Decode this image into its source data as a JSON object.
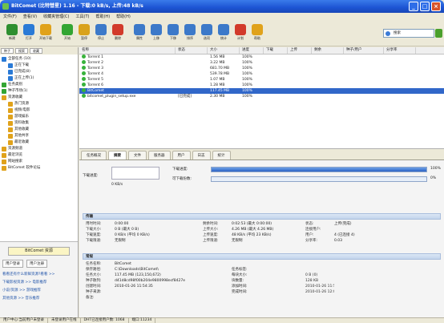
{
  "window": {
    "title": "BitComet (比特彗星) 1.16 - 下载:0 kB/s, 上传:48 kB/s"
  },
  "menu": [
    "文件(F)",
    "查看(V)",
    "收藏夹管理(C)",
    "工具(T)",
    "帮助(H)",
    "帮助(H)"
  ],
  "toolbar": {
    "tools": [
      {
        "label": "新建",
        "color": "#2f8f2f"
      },
      {
        "label": "打开",
        "color": "#2a7ad6"
      },
      {
        "label": "开始下载",
        "color": "#e0a21b"
      },
      {
        "label": "开始",
        "color": "#33a533"
      },
      {
        "label": "暂停",
        "color": "#d9a21b"
      },
      {
        "label": "停止",
        "color": "#3c79c9"
      },
      {
        "label": "删除",
        "color": "#d23a2a"
      },
      {
        "label": "属性",
        "color": "#3c79c9"
      },
      {
        "label": "上移",
        "color": "#3c79c9"
      },
      {
        "label": "下移",
        "color": "#3c79c9"
      },
      {
        "label": "排序",
        "color": "#3c79c9"
      },
      {
        "label": "选项",
        "color": "#3c79c9"
      },
      {
        "label": "统计",
        "color": "#3c79c9"
      },
      {
        "label": "计划",
        "color": "#d23a2a"
      },
      {
        "label": "帮助",
        "color": "#e0a21b"
      }
    ],
    "search_placeholder": "搜索"
  },
  "sidebar": {
    "tabs": [
      "种子",
      "搜索",
      "收藏"
    ],
    "tree": [
      {
        "label": "全部任务 (10)",
        "depth": 0,
        "color": "#2a7ad6"
      },
      {
        "label": "正在下载",
        "depth": 1,
        "color": "#2a7ad6"
      },
      {
        "label": "已完成(8)",
        "depth": 1,
        "color": "#2a7ad6"
      },
      {
        "label": "正在上传(1)",
        "depth": 1,
        "color": "#2a7ad6"
      },
      {
        "label": "任务类别",
        "depth": 0,
        "color": "#33a533"
      },
      {
        "label": "种子市场(1)",
        "depth": 0,
        "color": "#33a533"
      },
      {
        "label": "资源收藏",
        "depth": 0,
        "color": "#e0a21b"
      },
      {
        "label": "热门资源",
        "depth": 1,
        "color": "#e0a21b"
      },
      {
        "label": "视频/电影",
        "depth": 1,
        "color": "#e0a21b"
      },
      {
        "label": "游戏娱乐",
        "depth": 1,
        "color": "#e0a21b"
      },
      {
        "label": "资料收集",
        "depth": 1,
        "color": "#e0a21b"
      },
      {
        "label": "其他收藏",
        "depth": 1,
        "color": "#e0a21b"
      },
      {
        "label": "其他共享",
        "depth": 1,
        "color": "#e0a21b"
      },
      {
        "label": "最近收藏",
        "depth": 1,
        "color": "#e0a21b"
      },
      {
        "label": "资源频道",
        "depth": 0,
        "color": "#e0a21b"
      },
      {
        "label": "最近浏览",
        "depth": 0,
        "color": "#e0a21b"
      },
      {
        "label": "网站搜索",
        "depth": 0,
        "color": "#e0a21b"
      },
      {
        "label": "BitComet 软件论坛",
        "depth": 0,
        "color": "#e0a21b"
      }
    ],
    "ad_label": "BitComet 资源",
    "user_buttons": [
      "用户登录",
      "用户注册"
    ],
    "links": [
      "看看还有什么新鲜资源?看看 >>",
      "下载影视资源 >> 电影推荐",
      "小说/资源 >> 游戏推荐",
      "其他资源 >> 音乐推荐"
    ]
  },
  "list": {
    "columns": [
      "名称",
      "状态",
      "大小",
      "进度",
      "下载",
      "上传",
      "剩余",
      "种子/用户",
      "分享率"
    ],
    "rows": [
      {
        "name": "Torrent 1",
        "status": "",
        "size": "1.56 MB",
        "progress": "100%",
        "selected": false
      },
      {
        "name": "Torrent 2",
        "status": "",
        "size": "3.22 MB",
        "progress": "100%",
        "selected": false
      },
      {
        "name": "Torrent 3",
        "status": "",
        "size": "681.70 MB",
        "progress": "100%",
        "selected": false
      },
      {
        "name": "Torrent 4",
        "status": "",
        "size": "539.78 MB",
        "progress": "100%",
        "selected": false
      },
      {
        "name": "Torrent 5",
        "status": "",
        "size": "1.07 MB",
        "progress": "100%",
        "selected": false
      },
      {
        "name": "Torrent 6",
        "status": "",
        "size": "1.28 MB",
        "progress": "100%",
        "selected": false
      },
      {
        "name": "BitComet",
        "status": "",
        "size": "117.45 MB",
        "progress": "100%",
        "selected": true
      },
      {
        "name": "bitcomet_plugin_setup.exe",
        "status": "[已完成]",
        "size": "2.30 MB",
        "progress": "100%",
        "selected": false
      }
    ]
  },
  "details": {
    "tabs": [
      "任务概况",
      "摘要",
      "文件",
      "服务器",
      "用户",
      "日志",
      "统计"
    ],
    "downloaded_label": "下载进度:",
    "downloaded_value": "0 KB/s",
    "downloaded_fraction": 1.0,
    "downloaded_pct": "100%",
    "avail_label": "可下载份数:",
    "avail_pct": "0%",
    "transfer_header": "传输",
    "transfer_rows": [
      [
        "用时时间:",
        "0:00:00",
        "剩余时间:",
        "0:02:53 (最大 0:00:00)",
        "状态:",
        "上传(完成)"
      ],
      [
        "下载大小:",
        "0 B (最大 0 B)",
        "上传大小:",
        "4.26 MB (最大 4.26 MB)",
        "连接用户:",
        ""
      ],
      [
        "下载速度:",
        "0 KB/s (平均 0 KB/s)",
        "上传速度:",
        "48 KB/s (平均 23 KB/s)",
        "用户:",
        "4 (已连接 4)"
      ],
      [
        "下载限速:",
        "无限制",
        "上传限速:",
        "无限制",
        "分享率:",
        "0.03"
      ]
    ],
    "general_header": "常规",
    "general_rows": [
      [
        "任务名称:",
        "BitComet",
        "",
        "",
        "",
        ""
      ],
      [
        "保存路径:",
        "C:\\Downloads\\BitComet\\",
        "",
        "任务标签:",
        "",
        ""
      ],
      [
        "任务大小:",
        "117.45 MB (123,150,672)",
        "",
        "每块大小:",
        "0 B (0)",
        ""
      ],
      [
        "种子散列:",
        "d41d8cd98f00b204e9800998ecf8427e",
        "",
        "块数量:",
        "128 KB",
        ""
      ],
      [
        "创建时间:",
        "2010-01-26 11:54:35",
        "",
        "添加时间:",
        "2010-01-26 11:54:35",
        ""
      ],
      [
        "种子来源:",
        "",
        "",
        "完成时间:",
        "2010-01-26 12:04:58",
        ""
      ],
      [
        "备注:",
        "",
        "",
        "",
        "",
        ""
      ]
    ]
  },
  "statusbar": [
    "用户中心:当前用户未登录",
    "未登录用户在线",
    "DHT已连接用户数: 1068",
    "端口:11234"
  ]
}
